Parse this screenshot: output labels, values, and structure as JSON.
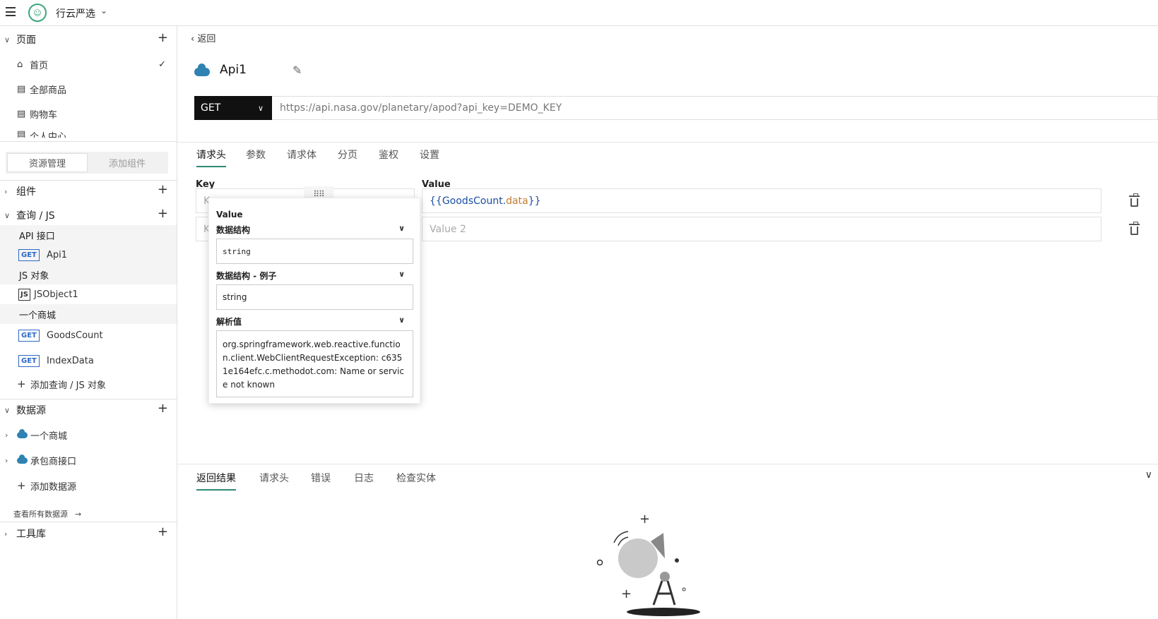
{
  "app": {
    "name": "行云严选"
  },
  "sidebar": {
    "pages_title": "页面",
    "pages": [
      {
        "label": "首页",
        "icon": "home-icon",
        "selected": true
      },
      {
        "label": "全部商品",
        "icon": "table-icon"
      },
      {
        "label": "购物车",
        "icon": "table-icon"
      },
      {
        "label": "个人中心",
        "icon": "table-icon"
      }
    ],
    "toggle": {
      "resources": "资源管理",
      "add_widget": "添加组件"
    },
    "widgets_title": "组件",
    "queries_title": "查询 / JS",
    "groups": {
      "api": "API 接口",
      "js": "JS 对象",
      "shop": "一个商城"
    },
    "queries": {
      "api1": {
        "method": "GET",
        "name": "Api1"
      },
      "jsobject": {
        "badge": "JS",
        "name": "JSObject1"
      },
      "goods": {
        "method": "GET",
        "name": "GoodsCount"
      },
      "index": {
        "method": "GET",
        "name": "IndexData"
      }
    },
    "add_query": "添加查询 / JS 对象",
    "datasources_title": "数据源",
    "datasources": [
      {
        "name": "一个商城"
      },
      {
        "name": "承包商接口"
      }
    ],
    "add_datasource": "添加数据源",
    "see_all": "查看所有数据源",
    "see_all_arrow": "→",
    "library_title": "工具库"
  },
  "main": {
    "back_label": "返回",
    "api_name": "Api1",
    "method": "GET",
    "url": "https://api.nasa.gov/planetary/apod?api_key=DEMO_KEY",
    "tabs": [
      "请求头",
      "参数",
      "请求体",
      "分页",
      "鉴权",
      "设置"
    ],
    "key_header": "Key",
    "value_header": "Value",
    "rows": {
      "row1": {
        "key_placeholder": "K",
        "value_prefix": "{{",
        "value_obj": "GoodsCount.",
        "value_prop": "data",
        "value_suffix": "}}"
      },
      "row2": {
        "key_placeholder": "K",
        "value_placeholder": "Value 2"
      }
    }
  },
  "popup": {
    "title": "Value",
    "schema_label": "数据结构",
    "schema_value": "string",
    "example_label": "数据结构 - 例子",
    "example_value": "string",
    "evaluated_label": "解析值",
    "evaluated_value": "org.springframework.web.reactive.function.client.WebClientRequestException: c6351e164efc.c.methodot.com: Name or service not known"
  },
  "response": {
    "tabs": [
      "返回结果",
      "请求头",
      "错误",
      "日志",
      "检查实体"
    ]
  },
  "colors": {
    "accent": "#2c8a72",
    "get_badge": "#2c68c5",
    "cloud": "#2f83b2"
  }
}
